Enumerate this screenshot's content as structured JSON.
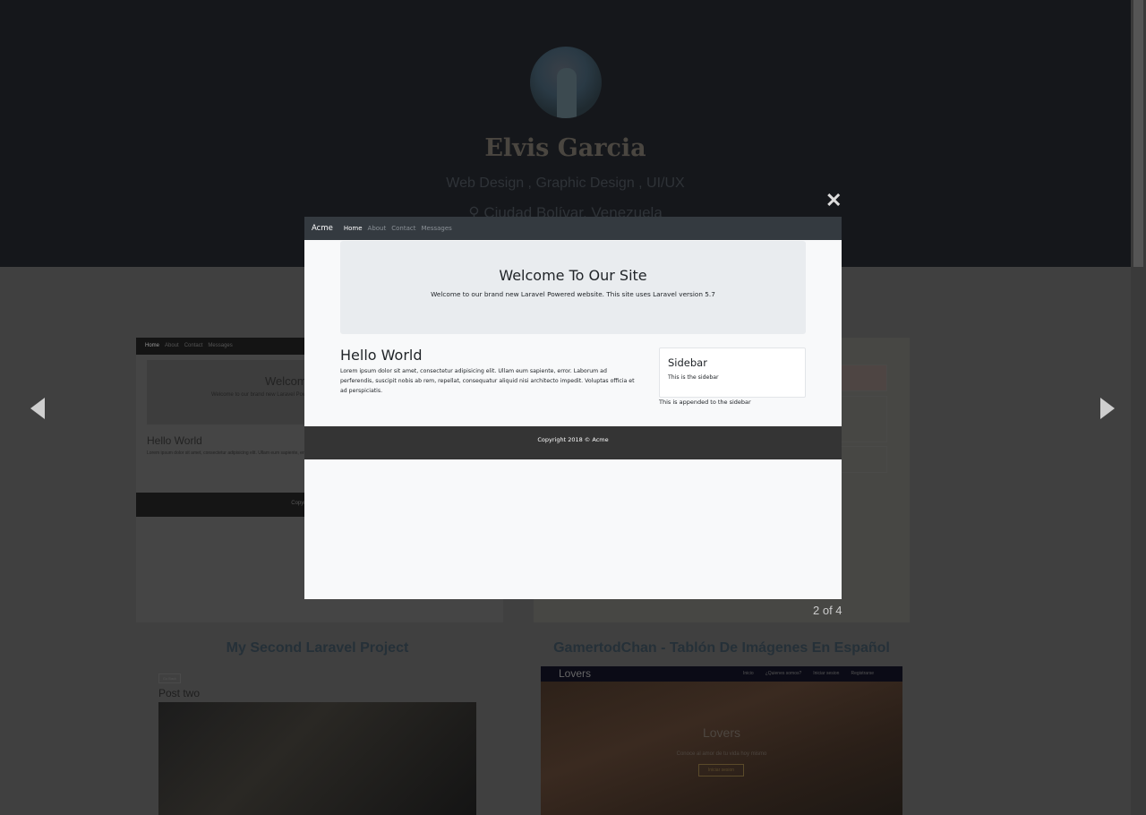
{
  "profile": {
    "name": "Elvis Garcia",
    "roles": "Web Design , Graphic Design , UI/UX",
    "location": "Ciudad Bolívar, Venezuela"
  },
  "projects": [
    {
      "title": "My Second Laravel Project",
      "preview": {
        "nav": [
          "Home",
          "About",
          "Contact",
          "Messages"
        ],
        "heading": "Welcome To Our Site",
        "sub": "Welcome to our brand new Laravel Powered website.",
        "hello": "Hello World",
        "text": "Lorem ipsum dolor sit amet, consectetur adipisicing elit. Ullam eum sapiente, error.",
        "footer": "Copyright 2018 © Acme",
        "go_back": "Go Back",
        "post_title": "Post two"
      }
    },
    {
      "title": "GamertodChan - Tablón De Imágenes En Español",
      "preview": {
        "brand": "Lovers",
        "nav": [
          "Inicio",
          "¿Quienes somos?",
          "Iniciar sesion",
          "Registrarse"
        ],
        "hero_title": "Lovers",
        "hero_sub": "Conoce al amor de tu vida hoy mismo",
        "hero_button": "Iniciar sesion"
      }
    }
  ],
  "lightbox": {
    "counter": "2 of 4",
    "close_icon": "close-x-icon",
    "prev_icon": "triangle-left-icon",
    "next_icon": "triangle-right-icon",
    "page": {
      "brand": "Acme",
      "nav": [
        "Home",
        "About",
        "Contact",
        "Messages"
      ],
      "jumbotron_title": "Welcome To Our Site",
      "jumbotron_text": "Welcome to our brand new Laravel Powered website. This site uses Laravel version 5.7",
      "heading": "Hello World",
      "body": "Lorem ipsum dolor sit amet, consectetur adipisicing elit. Ullam eum sapiente, error. Laborum ad perferendis, suscipit nobis ab rem, repellat, consequatur aliquid nisi architecto impedit. Voluptas officia et ad perspiciatis.",
      "sidebar_title": "Sidebar",
      "sidebar_text": "This is the sidebar",
      "sidebar_append": "This is appended to the sidebar",
      "footer": "Copyright 2018 © Acme"
    }
  }
}
